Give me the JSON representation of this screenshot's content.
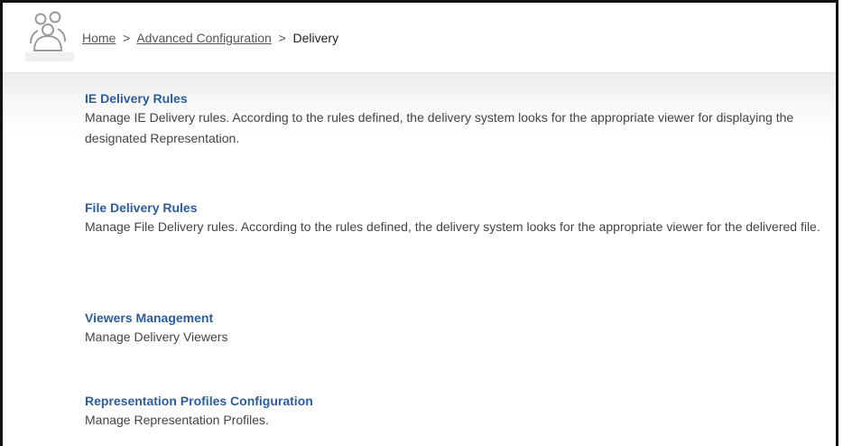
{
  "breadcrumb": {
    "home": "Home",
    "separator_1": ">",
    "advanced": "Advanced Configuration",
    "separator_2": ">",
    "current": "Delivery"
  },
  "sections": [
    {
      "title": "IE Delivery Rules",
      "description": "Manage IE Delivery rules. According to the rules defined, the delivery system looks for the appropriate viewer for displaying the designated Representation."
    },
    {
      "title": "File Delivery Rules",
      "description": "Manage File Delivery rules. According to the rules defined, the delivery system looks for the appropriate viewer for the delivered file."
    },
    {
      "title": "Viewers Management",
      "description": "Manage Delivery Viewers"
    },
    {
      "title": "Representation Profiles Configuration",
      "description": "Manage Representation Profiles."
    }
  ],
  "icons": {
    "header": "users-icon"
  },
  "colors": {
    "link_title": "#2e5c99",
    "frame_border": "#111111"
  }
}
